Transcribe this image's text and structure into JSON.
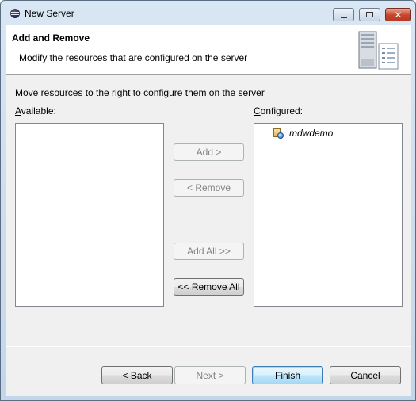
{
  "window": {
    "title": "New Server",
    "minimize_icon": "minimize-icon",
    "maximize_icon": "maximize-icon",
    "close_symbol": "✕"
  },
  "banner": {
    "title": "Add and Remove",
    "description": "Modify the resources that are configured on the server",
    "graphic_icon": "server-graphic-icon"
  },
  "main": {
    "instruction": "Move resources to the right to configure them on the server",
    "available_label": "Available:",
    "configured_label": "Configured:",
    "available_items": [],
    "configured_items": [
      {
        "label": "mdwdemo",
        "icon": "web-project-icon"
      }
    ],
    "buttons": {
      "add": "Add >",
      "remove": "< Remove",
      "add_all": "Add All >>",
      "remove_all": "<< Remove All"
    }
  },
  "footer": {
    "back": "< Back",
    "next": "Next >",
    "finish": "Finish",
    "cancel": "Cancel"
  },
  "colors": {
    "default_button_border": "#3c7fb1",
    "close_button": "#c6452c",
    "dialog_background": "#f0f0f0"
  }
}
